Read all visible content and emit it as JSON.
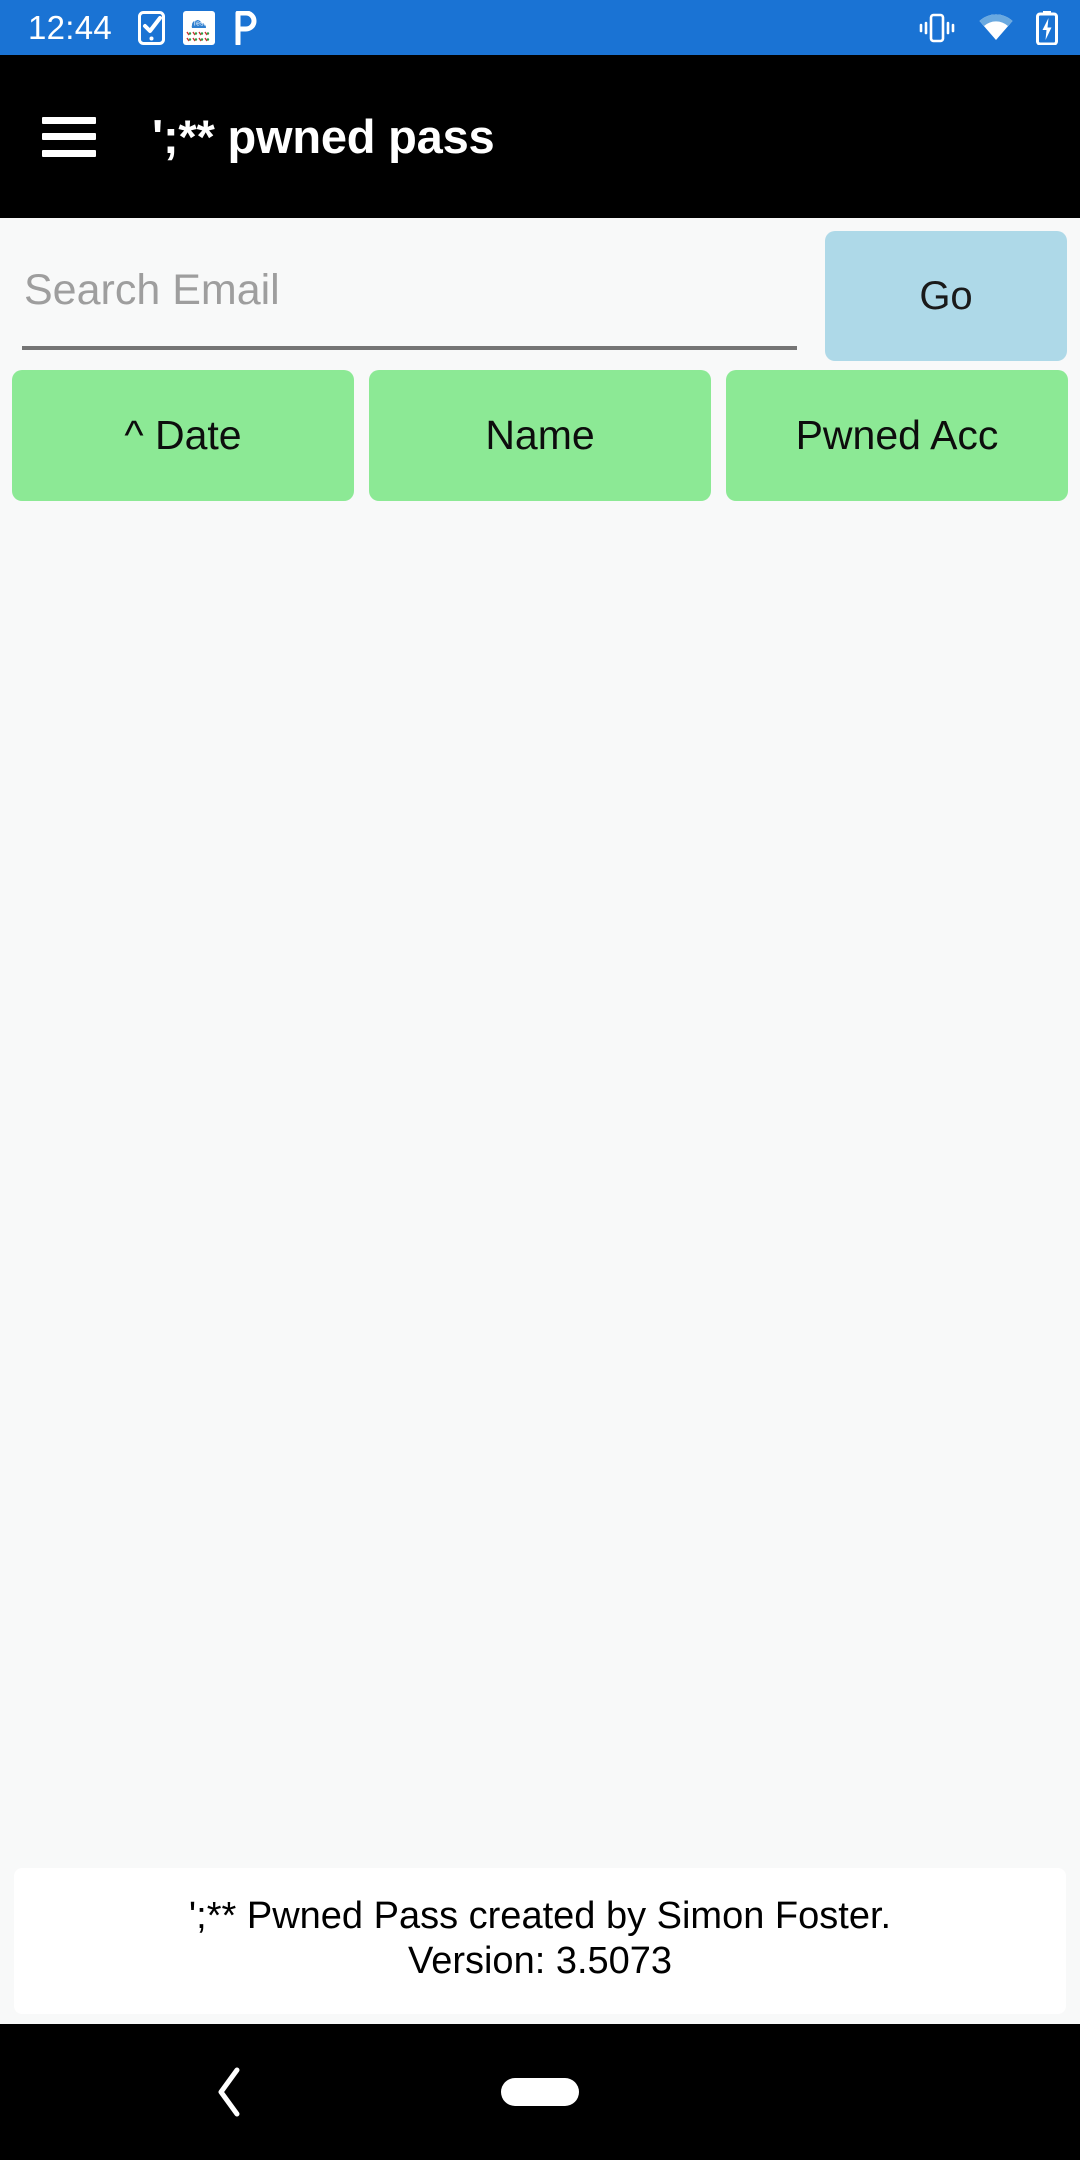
{
  "status_bar": {
    "time": "12:44",
    "background_color": "#1a73d4",
    "left_icons": [
      {
        "name": "phone-check-icon",
        "label": "phone-check"
      },
      {
        "name": "cloud-test-icon",
        "label": "Test"
      },
      {
        "name": "pinterest-p-icon",
        "label": "P"
      }
    ],
    "right_icons": [
      {
        "name": "vibrate-icon",
        "label": "vibrate"
      },
      {
        "name": "wifi-icon",
        "label": "wifi"
      },
      {
        "name": "battery-charging-icon",
        "label": "battery-charging"
      }
    ]
  },
  "app_bar": {
    "menu_icon": "hamburger-menu-icon",
    "title": "';** pwned pass",
    "background_color": "#000000",
    "text_color": "#ffffff"
  },
  "search": {
    "placeholder": "Search Email",
    "value": "",
    "go_label": "Go",
    "go_color": "#aed9e8"
  },
  "sort_buttons": {
    "color": "#8ce995",
    "items": [
      {
        "name": "sort-date-button",
        "label": "^ Date"
      },
      {
        "name": "sort-name-button",
        "label": "Name"
      },
      {
        "name": "sort-pwned-acc-button",
        "label": "Pwned Acc"
      }
    ]
  },
  "results": {
    "rows": [],
    "empty": true
  },
  "footer": {
    "line1": "';** Pwned Pass created by Simon Foster.",
    "line2": "Version: 3.5073"
  },
  "nav_bar": {
    "back_icon": "back-chevron-icon",
    "home_indicator": "home-pill-indicator",
    "background_color": "#000000"
  }
}
